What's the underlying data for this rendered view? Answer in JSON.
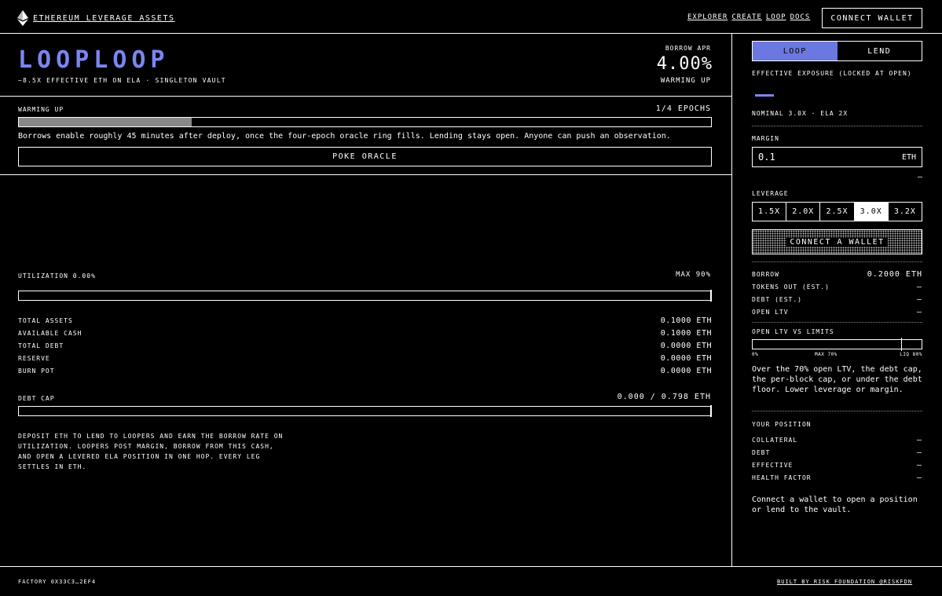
{
  "header": {
    "brand": "ETHEREUM LEVERAGE ASSETS",
    "nav": [
      "EXPLORER",
      "CREATE",
      "LOOP",
      "DOCS"
    ],
    "connect": "CONNECT WALLET"
  },
  "hero": {
    "title": "LOOPLOOP",
    "subtitle": "~8.5X EFFECTIVE ETH ON ELA · SINGLETON VAULT",
    "apr_label": "BORROW APR",
    "apr_value": "4.00%",
    "apr_status": "WARMING UP"
  },
  "warmup": {
    "label": "WARMING UP",
    "epochs": "1/4 EPOCHS",
    "progress": 0.25,
    "message": "Borrows enable roughly 45 minutes after deploy, once the four-epoch oracle ring fills. Lending stays open. Anyone can push an observation.",
    "button": "POKE ORACLE"
  },
  "utilization": {
    "label": "UTILIZATION 0.00%",
    "max": "MAX 90%",
    "value": 0.0
  },
  "stats": [
    {
      "k": "TOTAL ASSETS",
      "v": "0.1000 ETH"
    },
    {
      "k": "AVAILABLE CASH",
      "v": "0.1000 ETH"
    },
    {
      "k": "TOTAL DEBT",
      "v": "0.0000 ETH"
    },
    {
      "k": "RESERVE",
      "v": "0.0000 ETH"
    },
    {
      "k": "BURN POT",
      "v": "0.0000 ETH"
    }
  ],
  "debt_cap": {
    "label": "DEBT CAP",
    "value": "0.000 / 0.798 ETH",
    "fraction": 0.0
  },
  "about": "DEPOSIT ETH TO LEND TO LOOPERS AND EARN THE BORROW RATE ON UTILIZATION. LOOPERS POST MARGIN, BORROW FROM THIS CASH, AND OPEN A LEVERED ELA POSITION IN ONE HOP. EVERY LEG SETTLES IN ETH.",
  "side": {
    "tabs": [
      "LOOP",
      "LEND"
    ],
    "exposure_label": "EFFECTIVE EXPOSURE (LOCKED AT OPEN)",
    "nominal": "NOMINAL 3.0X · ELA 2X",
    "margin_label": "MARGIN",
    "margin_value": "0.1",
    "margin_unit": "ETH",
    "margin_hint": "—",
    "leverage_label": "LEVERAGE",
    "leverage_options": [
      "1.5X",
      "2.0X",
      "2.5X",
      "3.0X",
      "3.2X"
    ],
    "leverage_selected": "3.0X",
    "connect": "CONNECT A WALLET",
    "quote": [
      {
        "k": "BORROW",
        "v": "0.2000 ETH"
      },
      {
        "k": "TOKENS OUT (EST.)",
        "v": "—"
      },
      {
        "k": "DEBT (EST.)",
        "v": "—"
      },
      {
        "k": "OPEN LTV",
        "v": "—"
      }
    ],
    "ltv_label": "OPEN LTV VS LIMITS",
    "ltv_ticks": [
      "0%",
      "MAX 70%",
      "LIQ 80%"
    ],
    "ltv_marker": 0.88,
    "ltv_warning": "Over the 70% open LTV, the debt cap, the per-block cap, or under the debt floor. Lower leverage or margin.",
    "position_label": "YOUR POSITION",
    "position": [
      {
        "k": "COLLATERAL",
        "v": "—"
      },
      {
        "k": "DEBT",
        "v": "—"
      },
      {
        "k": "EFFECTIVE",
        "v": "—"
      },
      {
        "k": "HEALTH FACTOR",
        "v": "—"
      }
    ],
    "footer_text": "Connect a wallet to open a position or lend to the vault."
  },
  "footer": {
    "factory": "FACTORY 0X33C3…2EF4",
    "built": "BUILT BY RISK FOUNDATION @RISKFDN"
  },
  "colors": {
    "accent": "#7b86f2",
    "tab_active": "#6b78e0",
    "background": "#000000"
  }
}
